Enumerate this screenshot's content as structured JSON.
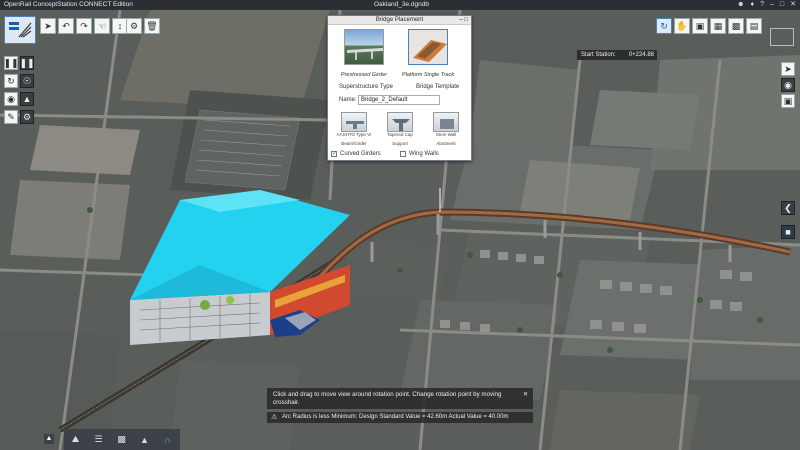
{
  "titlebar": {
    "app_title": "OpenRail ConceptStation CONNECT Edition",
    "file_name": "Oakland_3e.dgndb",
    "icons": [
      "user-icon",
      "bell-icon",
      "help-icon",
      "minimize-icon",
      "maximize-icon",
      "close-icon"
    ]
  },
  "toolbar": {
    "tools": [
      "select-icon",
      "undo-icon",
      "redo-icon",
      "pointer-icon",
      "measure-icon",
      "settings-icon",
      "delete-icon"
    ]
  },
  "dialog": {
    "title": "Bridge Placement",
    "superstructure_options": [
      {
        "caption": "Prestressed Girder"
      },
      {
        "caption": "Platform Single Track"
      }
    ],
    "superstructure_type_label": "Superstructure Type",
    "bridge_template_label": "Bridge Template",
    "name_label": "Name:",
    "name_value": "Bridge_2_Default",
    "components": [
      {
        "thumb_caption": "AASHTO Type VI",
        "role": "Beam/Girder"
      },
      {
        "thumb_caption": "Tapered Cap",
        "role": "Support"
      },
      {
        "thumb_caption": "Stem Wall",
        "role": "Abutment"
      }
    ],
    "curved_girders_label": "Curved Girders",
    "curved_girders_checked": true,
    "wing_walls_label": "Wing Walls",
    "wing_walls_checked": false
  },
  "station": {
    "label": "Start Station:",
    "value": "0+224.88"
  },
  "messages": {
    "hint": "Click and drag to move view around rotation point. Change rotation point by moving crosshair.",
    "warning": "Arc Radius is less Minimum: Design Standard Value = 42.60m Actual Value = 40.00m"
  },
  "bottombar": {
    "items": [
      "image-icon",
      "layers-icon",
      "buildings-icon",
      "terrain-icon",
      "bridge-icon"
    ]
  },
  "colors": {
    "accent": "#3a7fd0",
    "roof": "#22d3ee",
    "toolbar_bg": "#f5f5f5",
    "dark_panel": "#3c4248"
  }
}
